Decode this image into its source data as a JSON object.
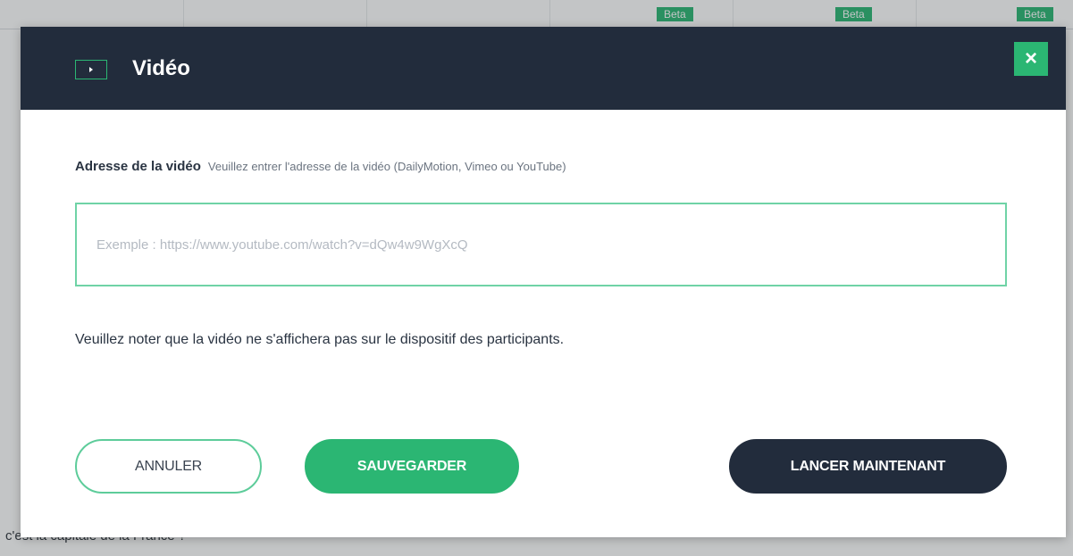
{
  "background": {
    "badges": [
      "Beta",
      "Beta",
      "Beta"
    ],
    "question_fragment": "c'est la capitale de la France ?"
  },
  "modal": {
    "title": "Vidéo",
    "header_icon": "video-icon",
    "close_icon": "close-icon",
    "close_symbol": "×",
    "field": {
      "label": "Adresse de la vidéo",
      "hint": "Veuillez entrer l'adresse de la vidéo (DailyMotion, Vimeo ou YouTube)",
      "value": "",
      "placeholder": "Exemple : https://www.youtube.com/watch?v=dQw4w9WgXcQ"
    },
    "note": "Veuillez noter que la vidéo ne s'affichera pas sur le dispositif des participants.",
    "buttons": {
      "cancel": "ANNULER",
      "save": "SAUVEGARDER",
      "launch": "LANCER MAINTENANT"
    }
  },
  "colors": {
    "header_bg": "#222c3c",
    "accent_green": "#2bb673",
    "dark_button": "#222c3c"
  }
}
